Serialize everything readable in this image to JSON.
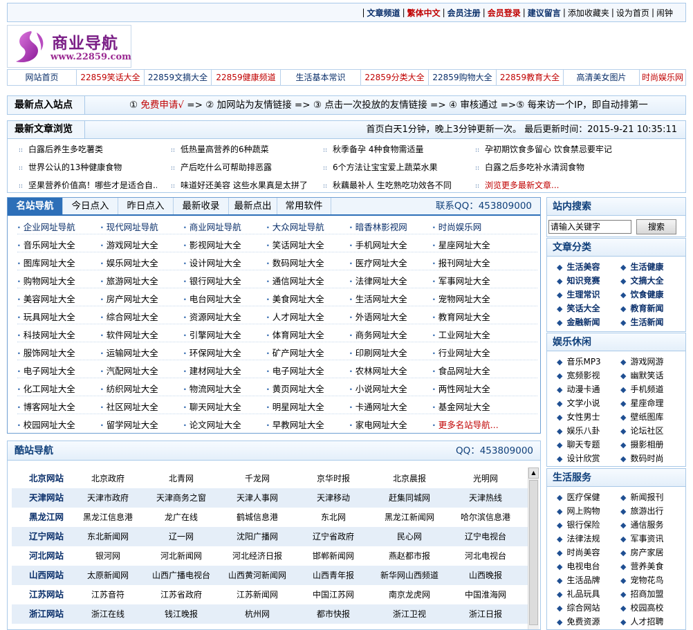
{
  "topbar": {
    "links": [
      {
        "label": "文章频道",
        "color": "#0a2f6a",
        "bold": true
      },
      {
        "label": "繁体中文",
        "color": "#c00000",
        "bold": true
      },
      {
        "label": "会员注册",
        "color": "#0a2f6a",
        "bold": true
      },
      {
        "label": "会员登录",
        "color": "#c00000",
        "bold": true
      },
      {
        "label": "建议留言",
        "color": "#0a2f6a",
        "bold": true
      },
      {
        "label": "添加收藏夹",
        "color": "#000000",
        "bold": false
      },
      {
        "label": "设为首页",
        "color": "#000000",
        "bold": false
      },
      {
        "label": "闹钟",
        "color": "#000000",
        "bold": false
      }
    ]
  },
  "logo": {
    "title": "商业导航",
    "url": "www.22859.com"
  },
  "nav": [
    {
      "label": "网站首页",
      "color": "#0a2f6a"
    },
    {
      "label": "22859笑话大全",
      "color": "#c00000"
    },
    {
      "label": "22859文摘大全",
      "color": "#0a2f6a"
    },
    {
      "label": "22859健康频道",
      "color": "#c00000"
    },
    {
      "label": "生活基本常识",
      "color": "#0a2f6a"
    },
    {
      "label": "22859分类大全",
      "color": "#c00000"
    },
    {
      "label": "22859购物大全",
      "color": "#0a2f6a"
    },
    {
      "label": "22859教育大全",
      "color": "#c00000"
    },
    {
      "label": "高清美女图片",
      "color": "#0a2f6a"
    },
    {
      "label": "时尚娱乐网",
      "color": "#c00000"
    }
  ],
  "newsite": {
    "label": "最新点入站点",
    "step1_num": "①",
    "step1": "免费申请√",
    "rest": " => ② 加网站为友情链接 => ③ 点击一次投放的友情链接 => ④ 审核通过 =>⑤ 每来访一个IP，即自动排第一"
  },
  "articles": {
    "label": "最新文章浏览",
    "update": "首页白天1分钟，晚上3分钟更新一次。 最后更新时间：2015-9-21 10:35:11",
    "items": [
      "白露后养生多吃薯类",
      "低热量高营养的6种蔬菜",
      "秋季备孕 4种食物需适量",
      "孕初期饮食多留心 饮食禁忌要牢记",
      "世界公认的13种健康食物",
      "产后吃什么可帮助排恶露",
      "6个方法让宝宝爱上蔬菜水果",
      "白露之后多吃补水清润食物",
      "坚果营养价值高！哪些才是适合自...",
      "味道好还美容 这些水果真是太拼了",
      "秋藕最补人 生吃熟吃功效各不同",
      "浏览更多最新文章..."
    ]
  },
  "tabs": {
    "items": [
      "名站导航",
      "今日点入",
      "昨日点入",
      "最新收录",
      "最新点出",
      "常用软件"
    ],
    "qq": "联系QQ：453809000"
  },
  "links": [
    [
      "企业网址导航",
      "现代网址导航",
      "商业网址导航",
      "大众网址导航",
      "暗香林影视网",
      "时尚娱乐网"
    ],
    [
      "音乐网址大全",
      "游戏网址大全",
      "影视网址大全",
      "笑话网址大全",
      "手机网址大全",
      "星座网址大全"
    ],
    [
      "图库网址大全",
      "娱乐网址大全",
      "设计网址大全",
      "数码网址大全",
      "医疗网址大全",
      "报刊网址大全"
    ],
    [
      "购物网址大全",
      "旅游网址大全",
      "银行网址大全",
      "通信网址大全",
      "法律网址大全",
      "军事网址大全"
    ],
    [
      "美容网址大全",
      "房产网址大全",
      "电台网址大全",
      "美食网址大全",
      "生活网址大全",
      "宠物网址大全"
    ],
    [
      "玩具网址大全",
      "综合网址大全",
      "资源网址大全",
      "人才网址大全",
      "外语网址大全",
      "教育网址大全"
    ],
    [
      "科技网址大全",
      "软件网址大全",
      "引擎网址大全",
      "体育网址大全",
      "商务网址大全",
      "工业网址大全"
    ],
    [
      "服饰网址大全",
      "运输网址大全",
      "环保网址大全",
      "矿产网址大全",
      "印刷网址大全",
      "行业网址大全"
    ],
    [
      "电子网址大全",
      "汽配网址大全",
      "建材网址大全",
      "电子网址大全",
      "农林网址大全",
      "食品网址大全"
    ],
    [
      "化工网址大全",
      "纺织网址大全",
      "物流网址大全",
      "黄页网址大全",
      "小说网址大全",
      "两性网址大全"
    ],
    [
      "博客网址大全",
      "社区网址大全",
      "聊天网址大全",
      "明星网址大全",
      "卡通网址大全",
      "基金网址大全"
    ],
    [
      "校园网址大全",
      "留学网址大全",
      "论文网址大全",
      "早教网址大全",
      "家电网址大全",
      "更多名站导航..."
    ]
  ],
  "coolnav": {
    "label": "酷站导航",
    "qq": "QQ：453809000",
    "rows": [
      {
        "region": "北京网站",
        "sites": [
          "北京政府",
          "北青网",
          "千龙网",
          "京华时报",
          "北京晨报",
          "光明网"
        ]
      },
      {
        "region": "天津网站",
        "sites": [
          "天津市政府",
          "天津商务之窗",
          "天津人事网",
          "天津移动",
          "赶集同城网",
          "天津热线"
        ]
      },
      {
        "region": "黑龙江网",
        "sites": [
          "黑龙江信息港",
          "龙广在线",
          "鹤城信息港",
          "东北网",
          "黑龙江新闻网",
          "哈尔滨信息港"
        ]
      },
      {
        "region": "辽宁网站",
        "sites": [
          "东北新闻网",
          "辽一网",
          "沈阳广播网",
          "辽宁省政府",
          "民心网",
          "辽宁电视台"
        ]
      },
      {
        "region": "河北网站",
        "sites": [
          "银河网",
          "河北新闻网",
          "河北经济日报",
          "邯郸新闻网",
          "燕赵都市报",
          "河北电视台"
        ]
      },
      {
        "region": "山西网站",
        "sites": [
          "太原新闻网",
          "山西广播电视台",
          "山西黄河新闻网",
          "山西青年报",
          "新华网山西频道",
          "山西晚报"
        ]
      },
      {
        "region": "江苏网站",
        "sites": [
          "江苏音符",
          "江苏省政府",
          "江苏新闻网",
          "中国江苏网",
          "南京龙虎网",
          "中国淮海网"
        ]
      },
      {
        "region": "浙江网站",
        "sites": [
          "浙江在线",
          "钱江晚报",
          "杭州网",
          "都市快报",
          "浙江卫视",
          "浙江日报"
        ]
      }
    ]
  },
  "search": {
    "title": "站内搜索",
    "placeholder": "请输入关键字",
    "button": "搜索"
  },
  "categories": {
    "title": "文章分类",
    "items": [
      "生活美容",
      "生活健康",
      "知识竞赛",
      "文摘大全",
      "生理常识",
      "饮食健康",
      "笑话大全",
      "教育新闻",
      "金融新闻",
      "生活新闻"
    ]
  },
  "leisure": {
    "title": "娱乐休闲",
    "items": [
      "音乐MP3",
      "游戏网游",
      "宽频影视",
      "幽默笑话",
      "动漫卡通",
      "手机频道",
      "文学小说",
      "星座命理",
      "女性男士",
      "壁纸图库",
      "娱乐八卦",
      "论坛社区",
      "聊天专题",
      "摄影相册",
      "设计欣赏",
      "数码时尚"
    ]
  },
  "lifesvc": {
    "title": "生活服务",
    "items": [
      "医疗保健",
      "新闻报刊",
      "网上购物",
      "旅游出行",
      "银行保险",
      "通信服务",
      "法律法规",
      "军事资讯",
      "时尚美容",
      "房产家居",
      "电视电台",
      "营养美食",
      "生活品牌",
      "宠物花鸟",
      "礼品玩具",
      "招商加盟",
      "综合网站",
      "校园高校",
      "免费资源",
      "人才招聘"
    ]
  }
}
